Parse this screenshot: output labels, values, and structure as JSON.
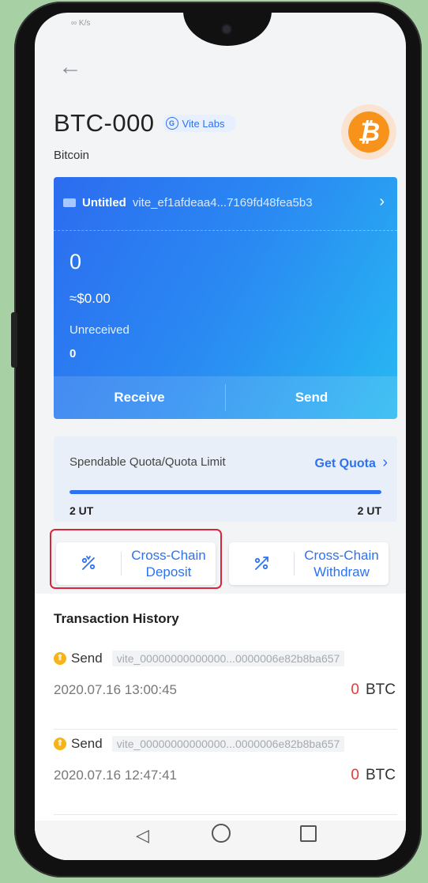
{
  "status": {
    "left": "∞ K/s",
    "right": ""
  },
  "header": {
    "back_glyph": "←",
    "token_title": "BTC-000",
    "issuer_badge": "Vite Labs",
    "issuer_icon_letter": "G",
    "subtitle": "Bitcoin",
    "logo_glyph": "₿"
  },
  "account_card": {
    "wallet_name": "Untitled",
    "address": "vite_ef1afdeaa4...7169fd48fea5b3",
    "balance": "0",
    "fiat": "≈$0.00",
    "unreceived_label": "Unreceived",
    "unreceived_value": "0",
    "receive_label": "Receive",
    "send_label": "Send"
  },
  "quota": {
    "label": "Spendable Quota/Quota Limit",
    "get_quota": "Get Quota",
    "chevron": "›",
    "spendable": "2 UT",
    "limit": "2 UT",
    "fill_fraction": 1.0
  },
  "cross_chain": {
    "deposit_label": "Cross-Chain Deposit",
    "withdraw_label": "Cross-Chain Withdraw"
  },
  "history": {
    "title": "Transaction History",
    "items": [
      {
        "type": "Send",
        "address": "vite_00000000000000...0000006e82b8ba657",
        "time": "2020.07.16 13:00:45",
        "amount": "0",
        "unit": "BTC"
      },
      {
        "type": "Send",
        "address": "vite_00000000000000...0000006e82b8ba657",
        "time": "2020.07.16 12:47:41",
        "amount": "0",
        "unit": "BTC"
      }
    ]
  },
  "colors": {
    "accent": "#2d72f0",
    "highlight": "#d9263b",
    "btc": "#f7931a"
  },
  "icons": [
    "back-arrow-icon",
    "vite-labs-badge-icon",
    "bitcoin-logo-icon",
    "wallet-icon",
    "chevron-right-icon",
    "cross-chain-deposit-icon",
    "cross-chain-withdraw-icon",
    "coin-icon",
    "nav-back-icon",
    "nav-home-icon",
    "nav-recent-icon"
  ]
}
